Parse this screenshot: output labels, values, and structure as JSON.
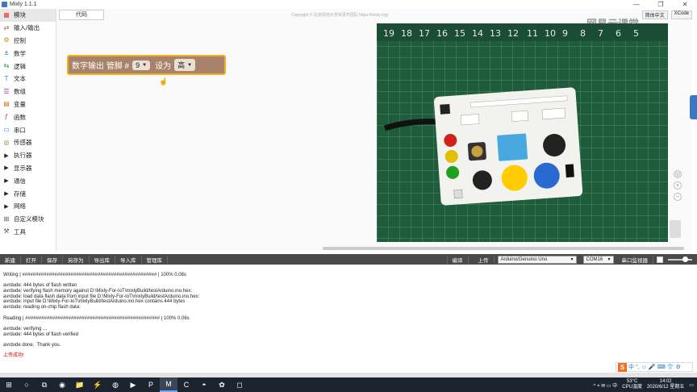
{
  "window": {
    "title": "Mixly 1.1.1",
    "controls": [
      "—",
      "❐",
      "✕"
    ]
  },
  "sidebar": {
    "items": [
      {
        "label": "模块",
        "icon": "module-icon",
        "glyph": "▦",
        "color": "#e04040",
        "arrow": false,
        "active": true
      },
      {
        "label": "输入/输出",
        "icon": "io-icon",
        "glyph": "⇄",
        "color": "#a06040",
        "arrow": false
      },
      {
        "label": "控制",
        "icon": "control-icon",
        "glyph": "⚙",
        "color": "#c09000",
        "arrow": false
      },
      {
        "label": "数学",
        "icon": "math-icon",
        "glyph": "±",
        "color": "#2060c0",
        "arrow": false
      },
      {
        "label": "逻辑",
        "icon": "logic-icon",
        "glyph": "⇆",
        "color": "#1a8a4a",
        "arrow": false
      },
      {
        "label": "文本",
        "icon": "text-icon",
        "glyph": "T",
        "color": "#2090b0",
        "arrow": false
      },
      {
        "label": "数组",
        "icon": "array-icon",
        "glyph": "☰",
        "color": "#8040a0",
        "arrow": false
      },
      {
        "label": "变量",
        "icon": "variable-icon",
        "glyph": "▤",
        "color": "#d07020",
        "arrow": false
      },
      {
        "label": "函数",
        "icon": "function-icon",
        "glyph": "ƒ",
        "color": "#a040a0",
        "arrow": false
      },
      {
        "label": "串口",
        "icon": "serial-icon",
        "glyph": "▭",
        "color": "#208080",
        "arrow": false
      },
      {
        "label": "传感器",
        "icon": "sensor-icon",
        "glyph": "◎",
        "color": "#6a8a20",
        "arrow": false
      },
      {
        "label": "执行器",
        "icon": "actuator-icon",
        "glyph": "▶",
        "color": "#222222",
        "arrow": true
      },
      {
        "label": "显示器",
        "icon": "display-icon",
        "glyph": "▶",
        "color": "#222222",
        "arrow": true
      },
      {
        "label": "通信",
        "icon": "communication-icon",
        "glyph": "▶",
        "color": "#222222",
        "arrow": true
      },
      {
        "label": "存储",
        "icon": "storage-icon",
        "glyph": "▶",
        "color": "#222222",
        "arrow": true
      },
      {
        "label": "网络",
        "icon": "network-icon",
        "glyph": "▶",
        "color": "#222222",
        "arrow": true
      },
      {
        "label": "自定义模块",
        "icon": "custom-module-icon",
        "glyph": "⊞",
        "color": "#555555",
        "arrow": false
      },
      {
        "label": "工具",
        "icon": "tools-icon",
        "glyph": "⚒",
        "color": "#555555",
        "arrow": false
      }
    ]
  },
  "workspace": {
    "tab_label": "代码",
    "copyright": "Copyright © 北京师范大学米思齐团队 https://mixly.org/",
    "lang_options": [
      "简体中文",
      "XCode"
    ],
    "watermark": "网易云课堂",
    "block": {
      "prefix": "数字输出 管脚 #",
      "pin_value": "9",
      "middle": "设为",
      "level_value": "高"
    }
  },
  "toolbar": {
    "left_buttons": [
      "新建",
      "打开",
      "保存",
      "另存为",
      "导出库",
      "导入库",
      "管理库"
    ],
    "compile_label": "编译",
    "upload_label": "上传",
    "board": "Arduino/Genuino Uno",
    "port": "COM16",
    "serial_monitor": "串口监视器"
  },
  "console": {
    "lines": [
      "Writing | ################################################## | 100% 0.08s",
      "",
      "avrdude: 444 bytes of flash written",
      "avrdude: verifying flash memory against D:\\Mixly-For-IoT\\mixlyBuild/testArduino.ino.hex:",
      "avrdude: load data flash data from input file D:\\Mixly-For-IoT\\mixlyBuild/testArduino.ino.hex:",
      "avrdude: input file D:\\Mixly-For-IoT\\mixlyBuild/testArduino.ino.hex contains 444 bytes",
      "avrdude: reading on-chip flash data:",
      "",
      "Reading | ################################################## | 100% 0.06s",
      "",
      "avrdude: verifying ...",
      "avrdude: 444 bytes of flash verified",
      "",
      "avrdude done.  Thank you.",
      "",
      "上传成功!"
    ]
  },
  "ime": {
    "logo": "S",
    "icons": [
      "中",
      "°,",
      "☺",
      "🎤",
      "⌨",
      "👕",
      "⚙"
    ]
  },
  "taskbar": {
    "apps": [
      "⊞",
      "○",
      "⧉",
      "◉",
      "📁",
      "⚡",
      "◍",
      "▶",
      "P",
      "M",
      "C",
      "◓",
      "✿",
      "◻"
    ],
    "temperature": "53°C",
    "temp_label": "CPU温度",
    "tray_icons": "^ ◓ ✉ ▭ 中",
    "time": "14:02",
    "date": "2020/6/12 星期五"
  },
  "colors": {
    "block_bg": "#a8826a",
    "block_border": "#f0b020",
    "toolbar_bg": "#4a4a4a",
    "taskbar_bg": "#1c2430"
  }
}
